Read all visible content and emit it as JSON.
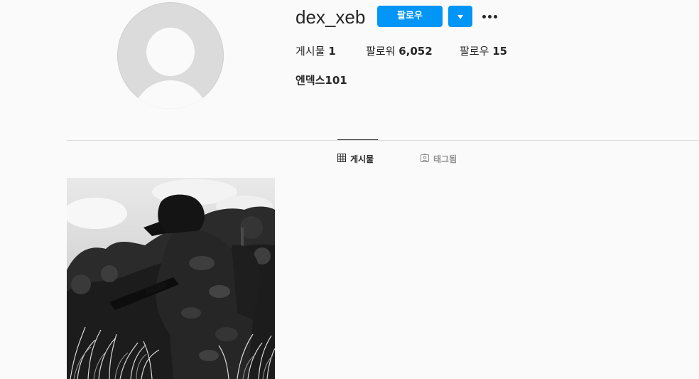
{
  "profile": {
    "username": "dex_xeb",
    "full_name": "엔덱스101",
    "follow_label": "팔로우",
    "stats": {
      "posts_label": "게시물",
      "posts_count": "1",
      "followers_label": "팔로워",
      "followers_count": "6,052",
      "following_label": "팔로우",
      "following_count": "15"
    }
  },
  "tabs": [
    {
      "label": "게시물",
      "icon": "grid-icon",
      "active": true
    },
    {
      "label": "태그됨",
      "icon": "tagged-icon",
      "active": false
    }
  ],
  "colors": {
    "accent": "#0095f6",
    "background": "#fafafa",
    "text": "#262626",
    "muted": "#8e8e8e"
  },
  "posts": [
    {
      "description_icon": "photo-icon"
    }
  ]
}
